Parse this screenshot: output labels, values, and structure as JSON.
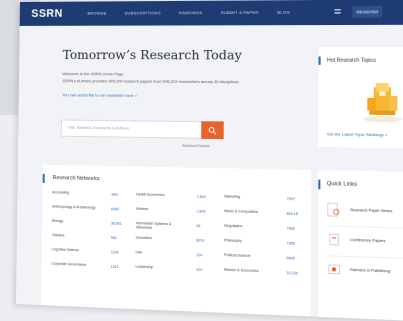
{
  "header": {
    "logo": "SSRN",
    "nav": [
      "BROWSE",
      "SUBSCRIPTIONS",
      "RANKINGS",
      "SUBMIT A PAPER",
      "BLOG"
    ],
    "register": "REGISTER"
  },
  "hero": {
    "title": "Tomorrow’s Research Today",
    "line1": "Welcome to the SSRN Home Page",
    "line2": "SSRN’s eLibrary provides 993,200 research papers from 546,224 researchers across 30 disciplines.",
    "link": "You can subscribe to our newsletter here  >"
  },
  "search": {
    "placeholder": "Title, Abstract, Keywords & Authors",
    "advanced": "Advanced Search"
  },
  "hot_topics": {
    "title": "Hot Research Topics",
    "link": "Get the Latest Topic Rankings  >"
  },
  "networks": {
    "title": "Research Networks",
    "rows": [
      [
        {
          "name": "Accounting",
          "val": "48%"
        },
        {
          "name": "Health Economics",
          "val": "1,824"
        },
        {
          "name": "Marketing",
          "val": "7937"
        }
      ],
      [
        {
          "name": "Anthropology & Archaeology",
          "val": "6480"
        },
        {
          "name": "Indexes",
          "val": "1,843"
        },
        {
          "name": "Music & Composition",
          "val": "849,18"
        }
      ],
      [
        {
          "name": "Biology",
          "val": "38,891"
        },
        {
          "name": "Information Systems & eBusiness",
          "val": "54"
        },
        {
          "name": "Negotiation",
          "val": "7456"
        }
      ],
      [
        {
          "name": "Classics",
          "val": "594"
        },
        {
          "name": "Innovation",
          "val": "8974"
        },
        {
          "name": "Philosophy",
          "val": "7958"
        }
      ],
      [
        {
          "name": "Cognitive Science",
          "val": "1234"
        },
        {
          "name": "Law",
          "val": "224"
        },
        {
          "name": "Political Science",
          "val": "5848"
        }
      ],
      [
        {
          "name": "Corporate Governance",
          "val": "1224"
        },
        {
          "name": "Leadership",
          "val": "424"
        },
        {
          "name": "Women & Economics",
          "val": "10,236"
        }
      ]
    ]
  },
  "quick_links": {
    "title": "Quick Links",
    "items": [
      "Research Paper Series",
      "Conference Papers",
      "Partners in Publishing"
    ]
  },
  "colors": {
    "topbar": "#1f3b73",
    "accent": "#2a6ebb",
    "search_button": "#e8632b"
  }
}
